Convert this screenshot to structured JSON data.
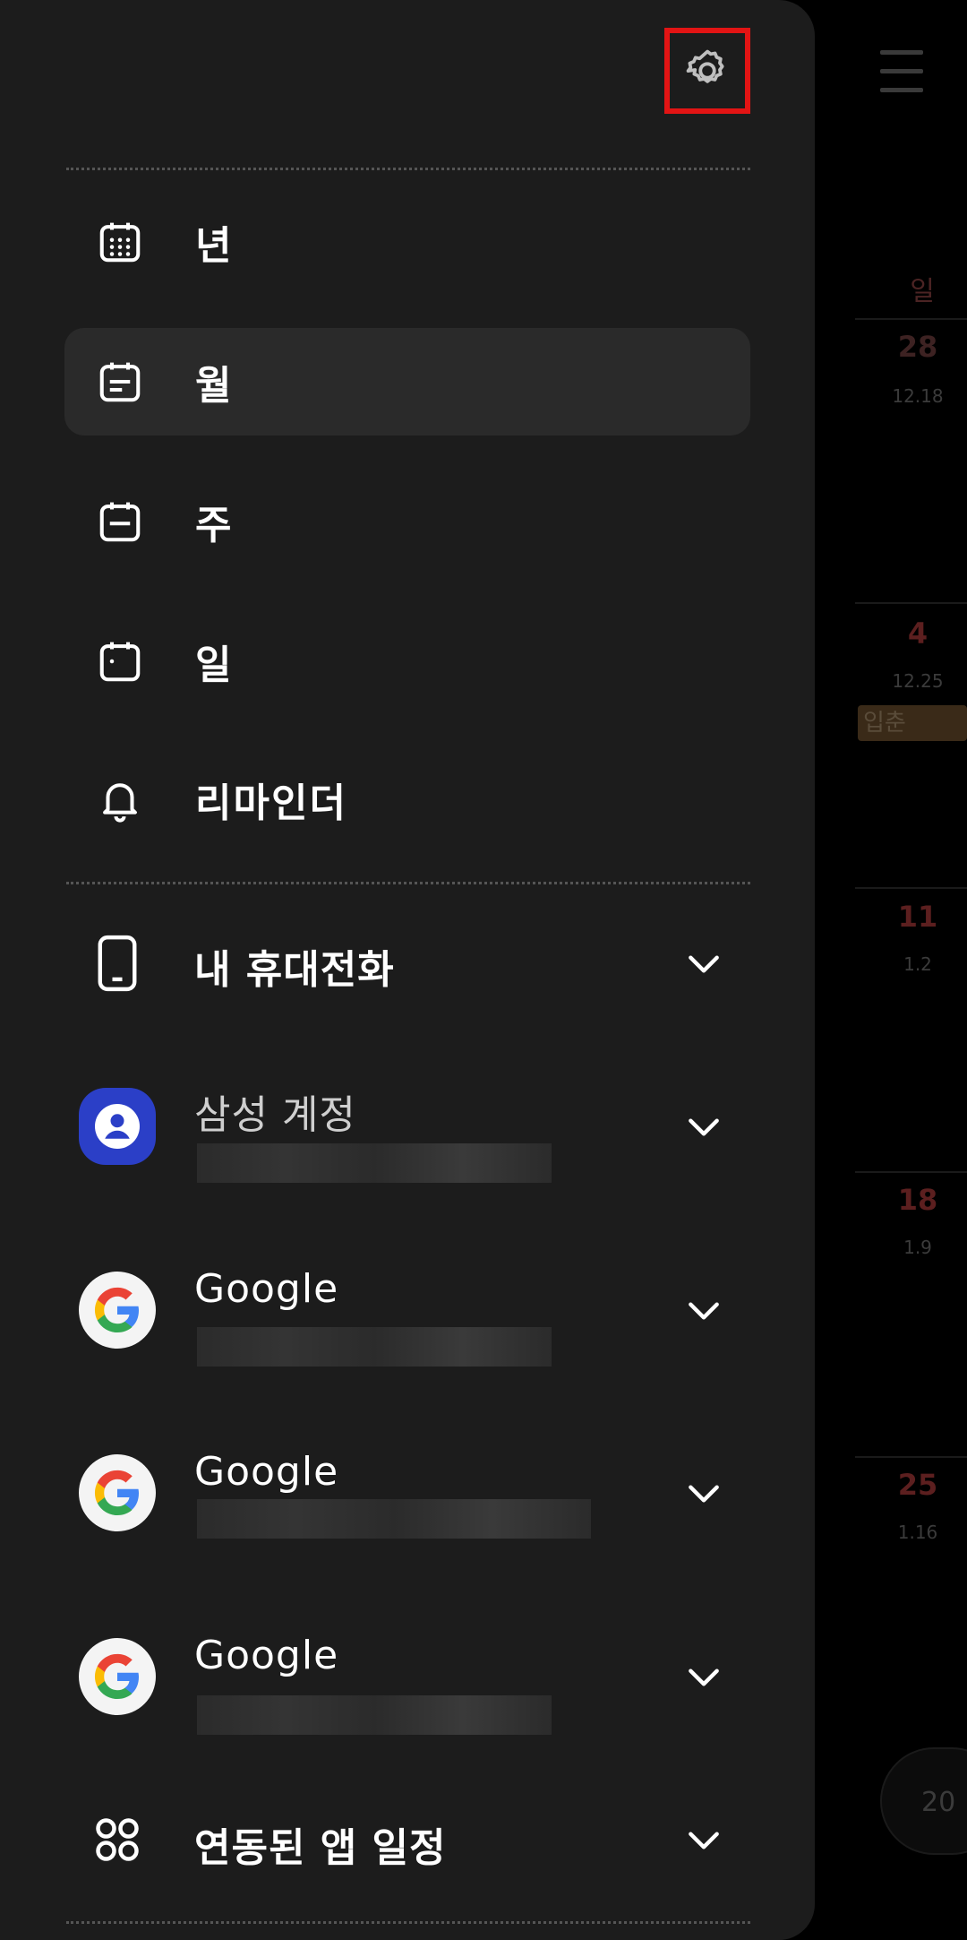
{
  "background_calendar": {
    "day_header": "일",
    "dates": [
      "28",
      "4",
      "11",
      "18",
      "25"
    ],
    "lunar": [
      "12.18",
      "12.25",
      "1.2",
      "1.9",
      "1.16"
    ],
    "event": "입춘",
    "year_pill": "20"
  },
  "drawer": {
    "settings_icon": "gear-icon",
    "views": [
      {
        "label": "년",
        "icon": "calendar-grid-icon",
        "selected": false
      },
      {
        "label": "월",
        "icon": "calendar-month-icon",
        "selected": true
      },
      {
        "label": "주",
        "icon": "calendar-week-icon",
        "selected": false
      },
      {
        "label": "일",
        "icon": "calendar-day-icon",
        "selected": false
      },
      {
        "label": "리마인더",
        "icon": "bell-icon",
        "selected": false
      }
    ],
    "accounts": [
      {
        "title": "내 휴대전화",
        "icon": "phone-icon"
      },
      {
        "title": "삼성 계정",
        "icon": "samsung-account-icon"
      },
      {
        "title": "Google",
        "icon": "google-icon"
      },
      {
        "title": "Google",
        "icon": "google-icon"
      },
      {
        "title": "Google",
        "icon": "google-icon"
      },
      {
        "title": "연동된 앱 일정",
        "icon": "apps-grid-icon"
      }
    ]
  },
  "colors": {
    "drawer_bg": "#1c1c1c",
    "selected_bg": "#2a2a2a",
    "highlight_border": "#e21414",
    "samsung_blue": "#2b3fc7"
  }
}
